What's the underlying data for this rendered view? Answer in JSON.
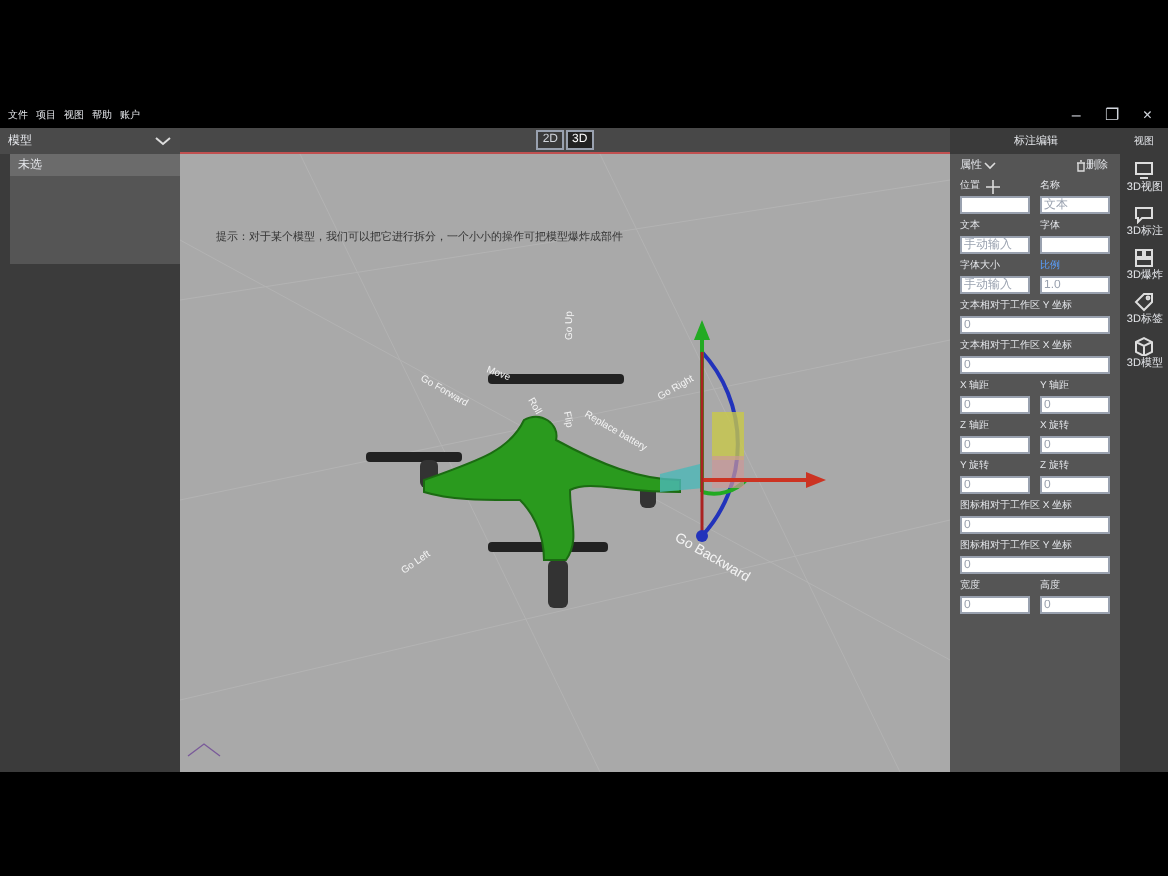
{
  "menu": [
    "文件",
    "项目",
    "视图",
    "帮助",
    "账户"
  ],
  "window_controls": [
    "–",
    "❐",
    "×"
  ],
  "left_panel": {
    "dropdown": "模型",
    "items": [
      {
        "label": "未选",
        "selected": true
      }
    ]
  },
  "view_toggle": [
    {
      "label": "2D",
      "selected": false
    },
    {
      "label": "3D",
      "selected": true
    }
  ],
  "viewport": {
    "tip": "提示：对于某个模型，我们可以把它进行拆分，一个小小的操作可把模型爆炸成部件",
    "scene_labels": [
      "Go Forward",
      "Move",
      "Go Up",
      "Roll",
      "Flip",
      "Replace battery",
      "Go Right",
      "Go Left",
      "Go Backward"
    ]
  },
  "properties": {
    "title": "标注编辑",
    "section": "属性",
    "delete": "删除",
    "fields": [
      {
        "kind": "half",
        "label": "位置",
        "icon": true,
        "highlighted": false
      },
      {
        "kind": "half",
        "label": "名称",
        "value": "文本",
        "highlighted": false
      },
      {
        "kind": "half",
        "label": "文本",
        "value": "手动输入",
        "highlighted": false
      },
      {
        "kind": "half",
        "label": "字体",
        "highlighted": false
      },
      {
        "kind": "half",
        "label": "字体大小",
        "value": "手动输入",
        "highlighted": false
      },
      {
        "kind": "half",
        "label": "比例",
        "value": "1.0",
        "highlighted": true
      },
      {
        "kind": "full",
        "label": "文本相对于工作区 Y 坐标",
        "value": "0",
        "highlighted": false
      },
      {
        "kind": "full",
        "label": "文本相对于工作区 X 坐标",
        "value": "0",
        "highlighted": false
      },
      {
        "kind": "half",
        "label": "X 轴距",
        "value": "0",
        "highlighted": false
      },
      {
        "kind": "half",
        "label": "Y 轴距",
        "value": "0",
        "highlighted": false
      },
      {
        "kind": "half",
        "label": "Z 轴距",
        "value": "0",
        "highlighted": false
      },
      {
        "kind": "half",
        "label": "X 旋转",
        "value": "0",
        "highlighted": false
      },
      {
        "kind": "half",
        "label": "Y 旋转",
        "value": "0",
        "highlighted": false
      },
      {
        "kind": "half",
        "label": "Z 旋转",
        "value": "0",
        "highlighted": false
      },
      {
        "kind": "full",
        "label": "图标相对于工作区 X 坐标",
        "value": "0",
        "highlighted": false
      },
      {
        "kind": "full",
        "label": "图标相对于工作区 Y 坐标",
        "value": "0",
        "highlighted": false
      },
      {
        "kind": "half",
        "label": "宽度",
        "value": "0",
        "highlighted": false
      },
      {
        "kind": "half",
        "label": "高度",
        "value": "0",
        "highlighted": false
      }
    ]
  },
  "tool_strip": {
    "title": "视图",
    "items": [
      {
        "label": "3D视图",
        "kind": "screen"
      },
      {
        "label": "3D标注",
        "kind": "bubble"
      },
      {
        "label": "3D爆炸",
        "kind": "explode"
      },
      {
        "label": "3D标签",
        "kind": "tag"
      },
      {
        "label": "3D模型",
        "kind": "box"
      }
    ]
  }
}
